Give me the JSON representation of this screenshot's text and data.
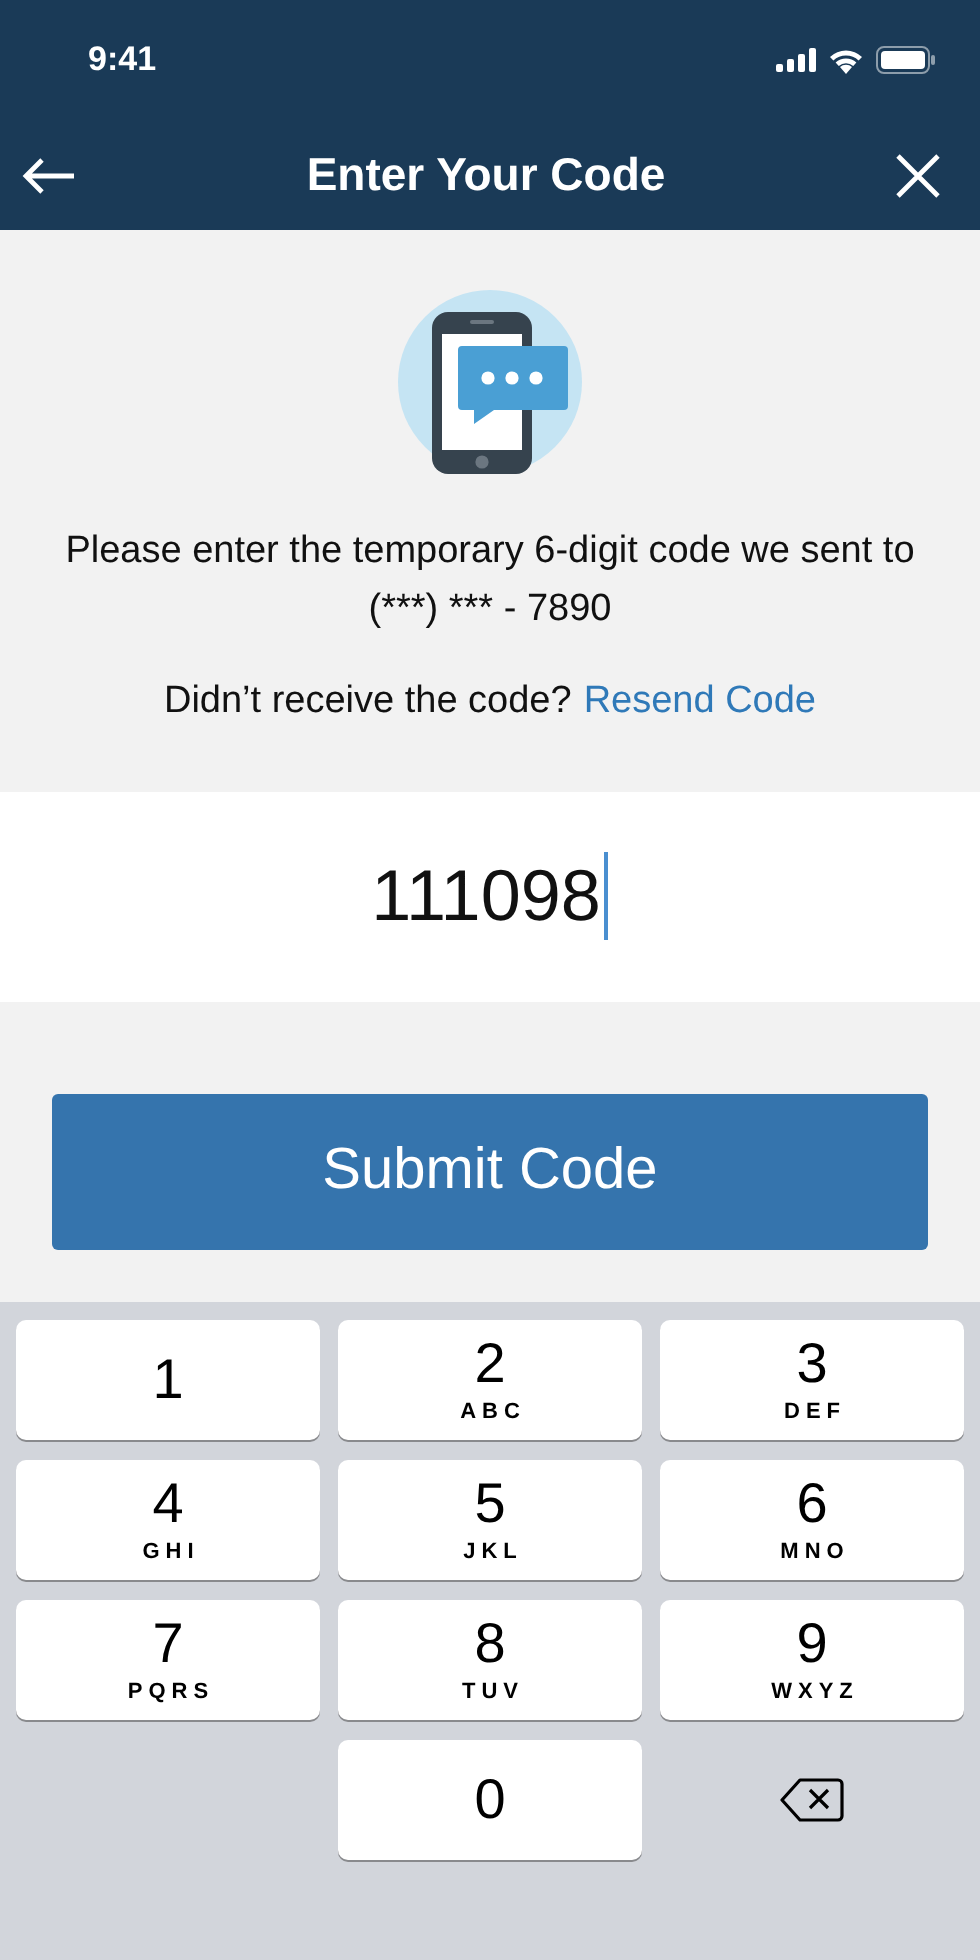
{
  "status_bar": {
    "time": "9:41"
  },
  "nav": {
    "title": "Enter Your Code"
  },
  "message": "Please enter the temporary 6-digit code we sent to (***) *** - 7890",
  "resend": {
    "prompt": "Didn’t receive the code?",
    "link": "Resend Code"
  },
  "code_field": {
    "value": "111098",
    "focused": true
  },
  "submit": {
    "label": "Submit Code"
  },
  "keypad": [
    {
      "kind": "digit",
      "digit": "1"
    },
    {
      "kind": "digit",
      "digit": "2",
      "letters": "ABC"
    },
    {
      "kind": "digit",
      "digit": "3",
      "letters": "DEF"
    },
    {
      "kind": "digit",
      "digit": "4",
      "letters": "GHI"
    },
    {
      "kind": "digit",
      "digit": "5",
      "letters": "JKL"
    },
    {
      "kind": "digit",
      "digit": "6",
      "letters": "MNO"
    },
    {
      "kind": "digit",
      "digit": "7",
      "letters": "PQRS"
    },
    {
      "kind": "digit",
      "digit": "8",
      "letters": "TUV"
    },
    {
      "kind": "digit",
      "digit": "9",
      "letters": "WXYZ"
    },
    {
      "kind": "blank"
    },
    {
      "kind": "digit",
      "digit": "0"
    },
    {
      "kind": "delete"
    }
  ]
}
